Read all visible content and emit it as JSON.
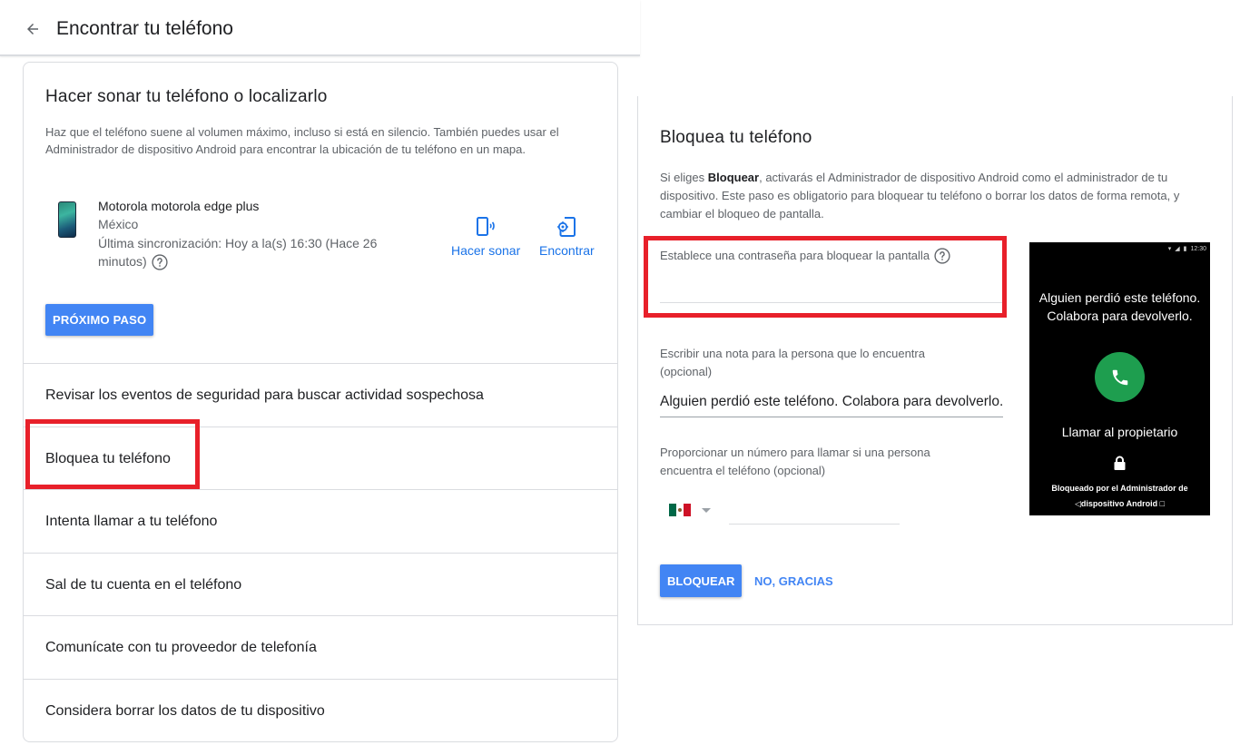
{
  "header": {
    "title": "Encontrar tu teléfono"
  },
  "left_card": {
    "title": "Hacer sonar tu teléfono o localizarlo",
    "description": "Haz que el teléfono suene al volumen máximo, incluso si está en silencio. También puedes usar el Administrador de dispositivo Android para encontrar la ubicación de tu teléfono en un mapa.",
    "device": {
      "name": "Motorola motorola edge plus",
      "country": "México",
      "last_sync": "Última sincronización: Hoy a la(s) 16:30 (Hace 26 minutos)"
    },
    "actions": {
      "ring": "Hacer sonar",
      "find": "Encontrar"
    },
    "next_button": "PRÓXIMO PASO",
    "items": [
      "Revisar los eventos de seguridad para buscar actividad sospechosa",
      "Bloquea tu teléfono",
      "Intenta llamar a tu teléfono",
      "Sal de tu cuenta en el teléfono",
      "Comunícate con tu proveedor de telefonía",
      "Considera borrar los datos de tu dispositivo"
    ]
  },
  "right_card": {
    "title": "Bloquea tu teléfono",
    "desc_prefix": "Si eliges ",
    "desc_bold": "Bloquear",
    "desc_suffix": ", activarás el Administrador de dispositivo Android como el administrador de tu dispositivo. Este paso es obligatorio para bloquear tu teléfono o borrar los datos de forma remota, y cambiar el bloqueo de pantalla.",
    "password_label": "Establece una contraseña para bloquear la pantalla",
    "note_label": "Escribir una nota para la persona que lo encuentra (opcional)",
    "note_value": "Alguien perdió este teléfono. Colabora para devolverlo.",
    "phone_label": "Proporcionar un número para llamar si una persona encuentra el teléfono (opcional)",
    "lock_button": "BLOQUEAR",
    "no_thanks_button": "NO, GRACIAS"
  },
  "phone_preview": {
    "status_time": "12:30",
    "message_line1": "Alguien perdió este teléfono.",
    "message_line2": "Colabora para devolverlo.",
    "call_owner": "Llamar al propietario",
    "footer_line1": "Bloqueado por el Administrador de",
    "footer_line2": "dispositivo Android"
  },
  "colors": {
    "accent": "#4285f4",
    "link": "#1a73e8",
    "highlight": "#e8202a",
    "call_green": "#1e9e4f"
  }
}
